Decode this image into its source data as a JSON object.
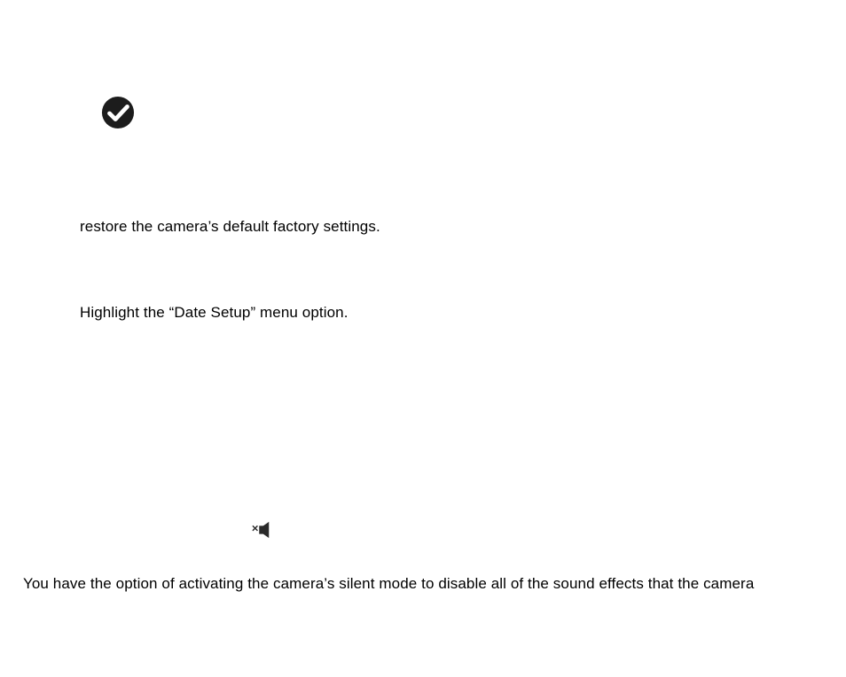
{
  "paragraphs": {
    "restore_line": "restore the camera’s default factory settings.",
    "highlight_line": "Highlight the “Date Setup” menu option.",
    "silent_mode_line": "You have the option of activating the camera’s silent mode to disable all of the sound effects that the camera"
  }
}
